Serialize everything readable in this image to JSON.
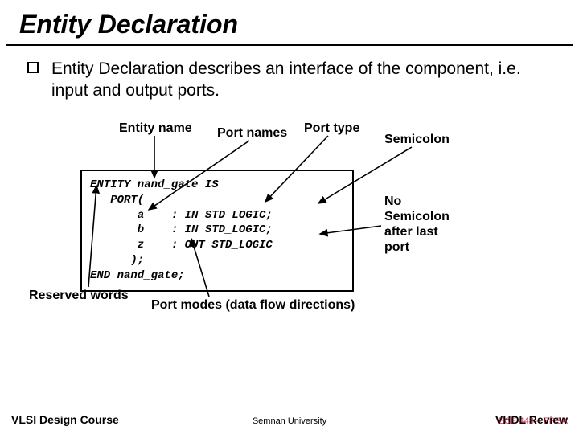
{
  "title": "Entity Declaration",
  "paragraph": "Entity Declaration describes an interface of the  component, i.e. input and output ports.",
  "labels": {
    "entity_name": "Entity name",
    "port_names": "Port names",
    "port_type": "Port type",
    "semicolon": "Semicolon",
    "reserved_words": "Reserved words",
    "port_modes": "Port modes (data flow directions)"
  },
  "notes": {
    "no_semicolon_l1": "No",
    "no_semicolon_l2": "Semicolon",
    "no_semicolon_l3": "after last",
    "no_semicolon_l4": "port"
  },
  "code": {
    "l1": "ENTITY nand_gate IS",
    "l2": "   PORT(",
    "l3": "       a    : IN STD_LOGIC;",
    "l4": "       b    : IN STD_LOGIC;",
    "l5": "       z    : OUT STD_LOGIC",
    "l6": "      );",
    "l7": "END nand_gate;"
  },
  "footer": {
    "left": "VLSI Design Course",
    "center": "Semnan University",
    "right": "VHDL Review",
    "right_overlay": "ECE 448 – FPGA"
  }
}
